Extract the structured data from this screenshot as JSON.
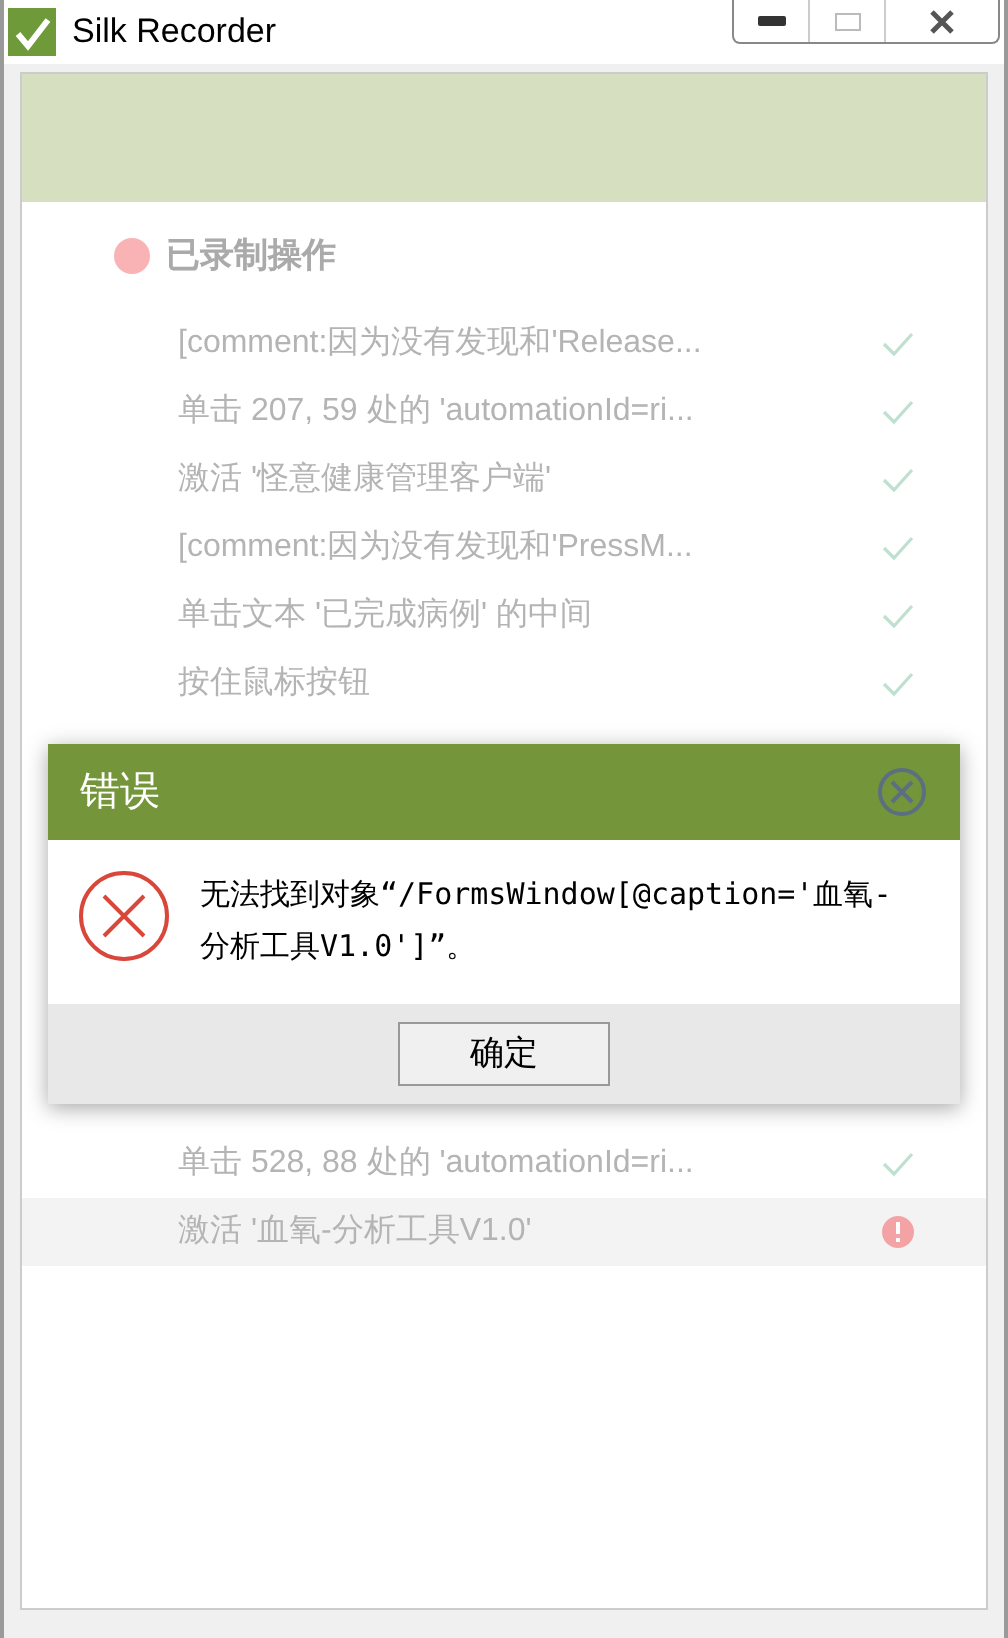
{
  "window": {
    "title": "Silk Recorder"
  },
  "section": {
    "title": "已录制操作",
    "color": "#f9b3b5"
  },
  "steps_above_dialog": [
    {
      "text": "[comment:因为没有发现和'Release...",
      "kind": "ok",
      "selected": false
    },
    {
      "text": "单击 207, 59 处的 'automationId=ri...",
      "kind": "ok",
      "selected": false
    },
    {
      "text": "激活 '怪意健康管理客户端'",
      "kind": "ok",
      "selected": false
    },
    {
      "text": "[comment:因为没有发现和'PressM...",
      "kind": "ok",
      "selected": false
    },
    {
      "text": "单击文本 '已完成病例' 的中间",
      "kind": "ok",
      "selected": false
    },
    {
      "text": "按住鼠标按钮",
      "kind": "ok",
      "selected": false
    }
  ],
  "steps_below_dialog": [
    {
      "text": "单击 528, 88 处的 'automationId=ri...",
      "kind": "ok",
      "selected": false
    },
    {
      "text": "激活 '血氧-分析工具V1.0'",
      "kind": "error",
      "selected": true
    }
  ],
  "dialog": {
    "title": "错误",
    "message": "无法找到对象“/FormsWindow[@caption='血氧-分析工具V1.0']”。",
    "button": "确定"
  }
}
